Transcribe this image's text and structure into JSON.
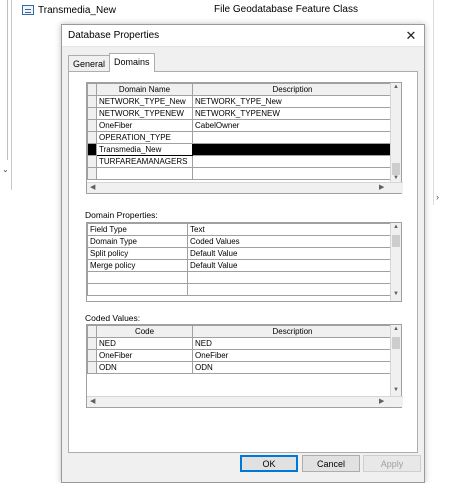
{
  "background": {
    "item_name": "Transmedia_New",
    "item_type": "File Geodatabase Feature Class",
    "item_icon": "feature-class-icon"
  },
  "dialog": {
    "title": "Database Properties",
    "tabs": [
      {
        "label": "General",
        "active": false
      },
      {
        "label": "Domains",
        "active": true
      }
    ],
    "domains_grid": {
      "headers": [
        "Domain Name",
        "Description"
      ],
      "rows": [
        {
          "name": "NETWORK_TYPE_New",
          "description": "NETWORK_TYPE_New"
        },
        {
          "name": "NETWORK_TYPENEW",
          "description": "NETWORK_TYPENEW"
        },
        {
          "name": "OneFiber",
          "description": "CabelOwner"
        },
        {
          "name": "OPERATION_TYPE",
          "description": ""
        },
        {
          "name": "Transmedia_New",
          "description": ""
        },
        {
          "name": "TURFAREAMANAGERS",
          "description": ""
        }
      ],
      "selected_row": 4
    },
    "domain_properties": {
      "label": "Domain Properties:",
      "rows": [
        {
          "property": "Field Type",
          "value": "Text"
        },
        {
          "property": "Domain Type",
          "value": "Coded Values"
        },
        {
          "property": "Split policy",
          "value": "Default Value"
        },
        {
          "property": "Merge policy",
          "value": "Default Value"
        }
      ]
    },
    "coded_values": {
      "label": "Coded Values:",
      "headers": [
        "Code",
        "Description"
      ],
      "rows": [
        {
          "code": "NED",
          "description": "NED"
        },
        {
          "code": "OneFiber",
          "description": "OneFiber"
        },
        {
          "code": "ODN",
          "description": "ODN"
        }
      ]
    },
    "buttons": {
      "ok": "OK",
      "cancel": "Cancel",
      "apply": "Apply"
    }
  },
  "colors": {
    "dialog_bg": "#f0f0f0",
    "selection": "#000000",
    "focus_border": "#0078d7"
  }
}
